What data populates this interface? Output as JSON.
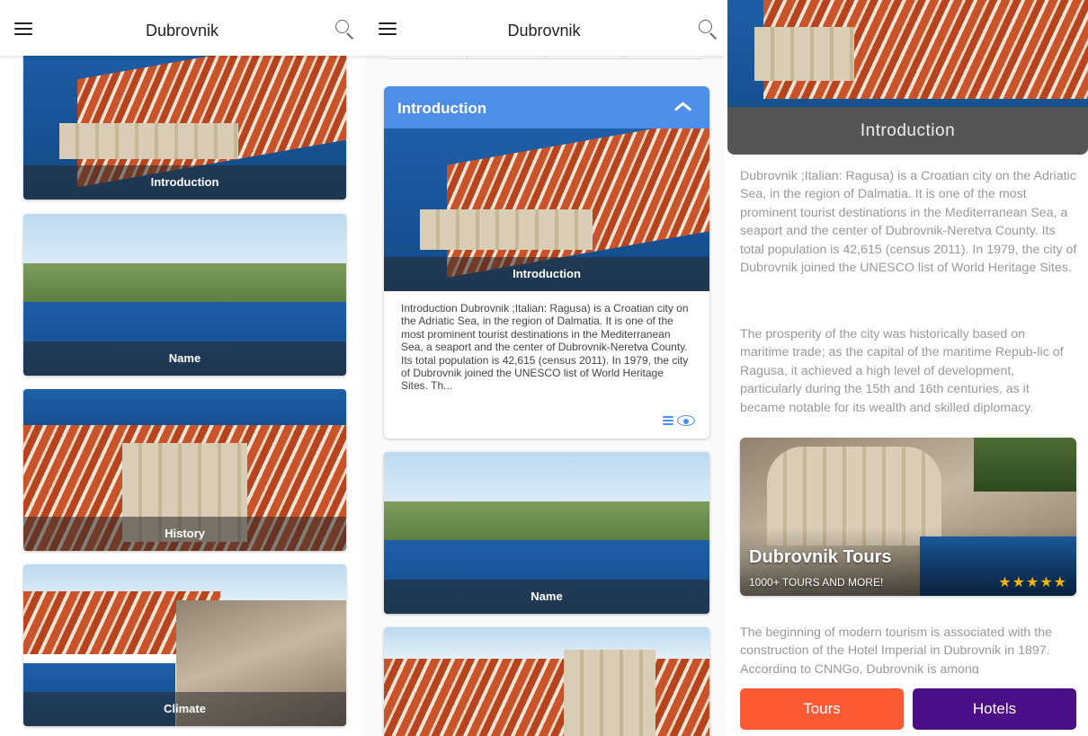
{
  "colors": {
    "accent_blue": "#4d8fe8",
    "tours_button": "#fb5a35",
    "hotels_button": "#4a0f86",
    "star": "#f5b301"
  },
  "screen1": {
    "title": "Dubrovnik",
    "menu_icon": "hamburger-menu-icon",
    "search_icon": "search-icon",
    "cards": [
      {
        "label": "Introduction"
      },
      {
        "label": "Name"
      },
      {
        "label": "History"
      },
      {
        "label": "Climate"
      }
    ]
  },
  "screen2": {
    "title": "Dubrovnik",
    "expanded": {
      "header": "Introduction",
      "image_caption": "Introduction",
      "text": "Introduction Dubrovnik ;Italian: Ragusa) is a Croatian city on the Adriatic Sea, in the region of Dalmatia. It is one of the most prominent tourist destinations in the Mediterranean Sea, a seaport and the center of Dubrovnik-Neretva County. Its total population is 42,615 (census 2011). In 1979, the city of Dubrovnik joined the UNESCO list of World Heritage Sites. Th...",
      "read_more_icon": "read-more-eye-icon"
    },
    "cards": [
      {
        "label": "Name"
      }
    ]
  },
  "screen3": {
    "hero_caption": "Introduction",
    "para1": "Dubrovnik ;Italian: Ragusa) is a Croatian city on the Adriatic Sea, in the region of Dalmatia. It is one of the most prominent tourist destinations in the Mediterranean Sea, a seaport and the center of Dubrovnik-Neretva County. Its total population is 42,615 (census 2011). In 1979, the city of Dubrovnik joined the UNESCO list of World Heritage Sites.",
    "para2": "The prosperity of the city was historically based on maritime trade; as the capital of the maritime Repub-lic of Ragusa, it achieved a high level of development, particularly during the 15th and 16th centuries, as it became notable for its wealth and skilled diplomacy.",
    "promo": {
      "title": "Dubrovnik Tours",
      "subtitle": "1000+ TOURS AND MORE!",
      "stars": "★★★★★",
      "rating": 5
    },
    "para3": "The beginning of modern tourism is associated with the construction of the Hotel Imperial in Dubrovnik in 1897. According to CNNGo, Dubrovnik is among",
    "buttons": {
      "tours": "Tours",
      "hotels": "Hotels"
    }
  }
}
